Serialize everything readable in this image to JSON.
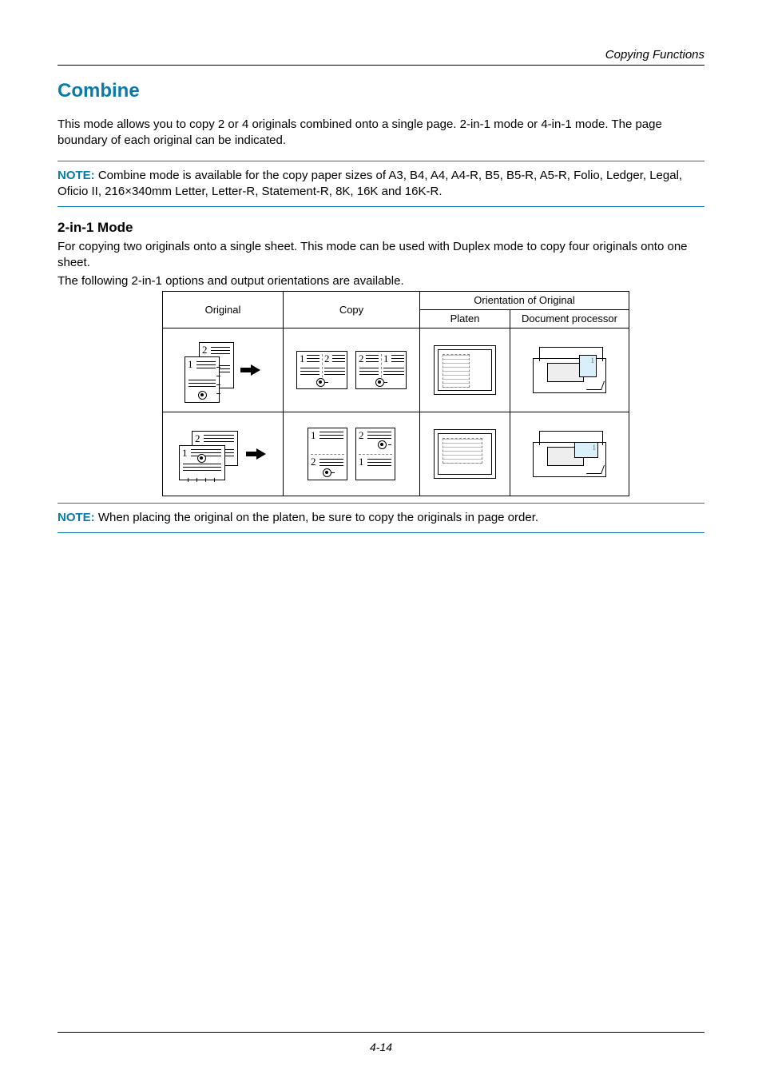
{
  "header": {
    "running_head": "Copying Functions"
  },
  "title": "Combine",
  "intro": "This mode allows you to copy 2 or 4 originals combined onto a single page. 2-in-1 mode or 4-in-1 mode. The page boundary of each original can be indicated.",
  "note1": {
    "label": "NOTE:",
    "text": " Combine mode is available for the copy paper sizes of A3, B4, A4, A4-R, B5, B5-R, A5-R, Folio, Ledger, Legal, Oficio II, 216×340mm Letter, Letter-R, Statement-R, 8K, 16K and 16K-R."
  },
  "section_title": "2-in-1 Mode",
  "section_body": "For copying two originals onto a single sheet. This mode can be used with Duplex mode to copy four originals onto one sheet.",
  "section_lead": "The following 2-in-1 options and output orientations are available.",
  "table": {
    "headers": {
      "original": "Original",
      "copy": "Copy",
      "orientation": "Orientation of Original",
      "platen": "Platen",
      "docproc": "Document processor"
    }
  },
  "diagram_labels": {
    "n1": "1",
    "n2": "2"
  },
  "note2": {
    "label": "NOTE:",
    "text": " When placing the original on the platen, be sure to copy the originals in page order."
  },
  "footer": {
    "page_number": "4-14"
  }
}
